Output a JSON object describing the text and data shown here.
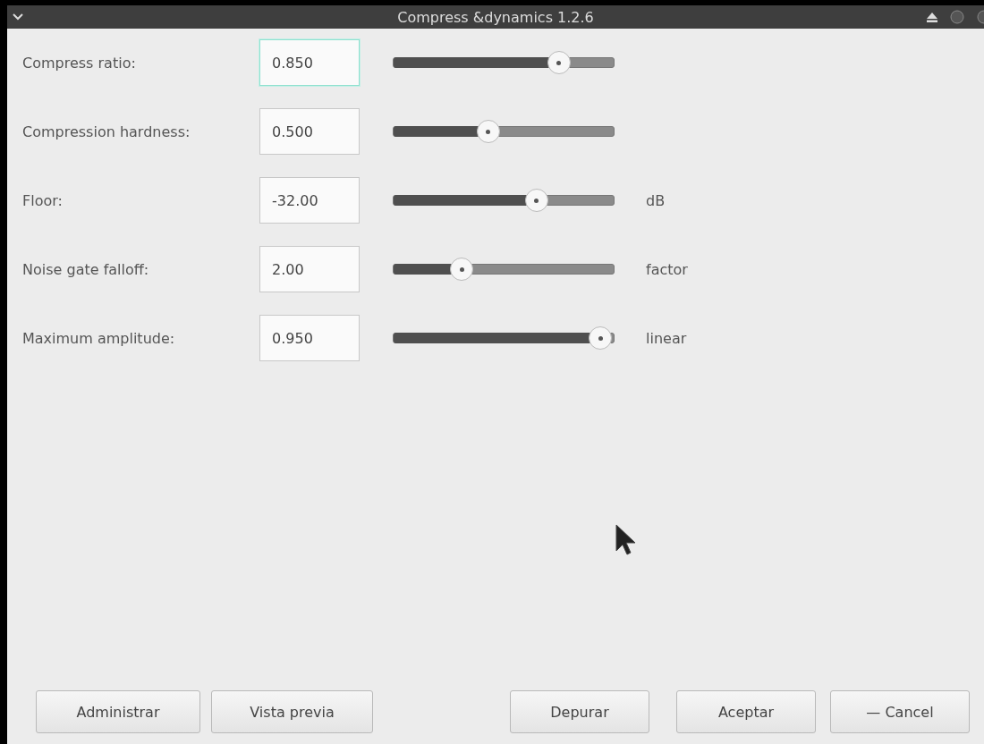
{
  "window": {
    "title": "Compress &dynamics 1.2.6"
  },
  "rows": [
    {
      "label": "Compress ratio:",
      "value": "0.850",
      "focused": true,
      "level": 0.75
    },
    {
      "label": "Compression hardness:",
      "value": "0.500",
      "focused": false,
      "level": 0.43
    },
    {
      "label": "Floor:",
      "value": "-32.00",
      "focused": false,
      "level": 0.65,
      "unit": "dB"
    },
    {
      "label": "Noise gate falloff:",
      "value": "2.00",
      "focused": false,
      "level": 0.31,
      "unit": "factor"
    },
    {
      "label": "Maximum amplitude:",
      "value": "0.950",
      "focused": false,
      "level": 0.94,
      "unit": "linear"
    }
  ],
  "buttons_left": [
    "Administrar",
    "Vista previa"
  ],
  "buttons_right": [
    "Depurar",
    "Aceptar",
    "— Cancel"
  ]
}
